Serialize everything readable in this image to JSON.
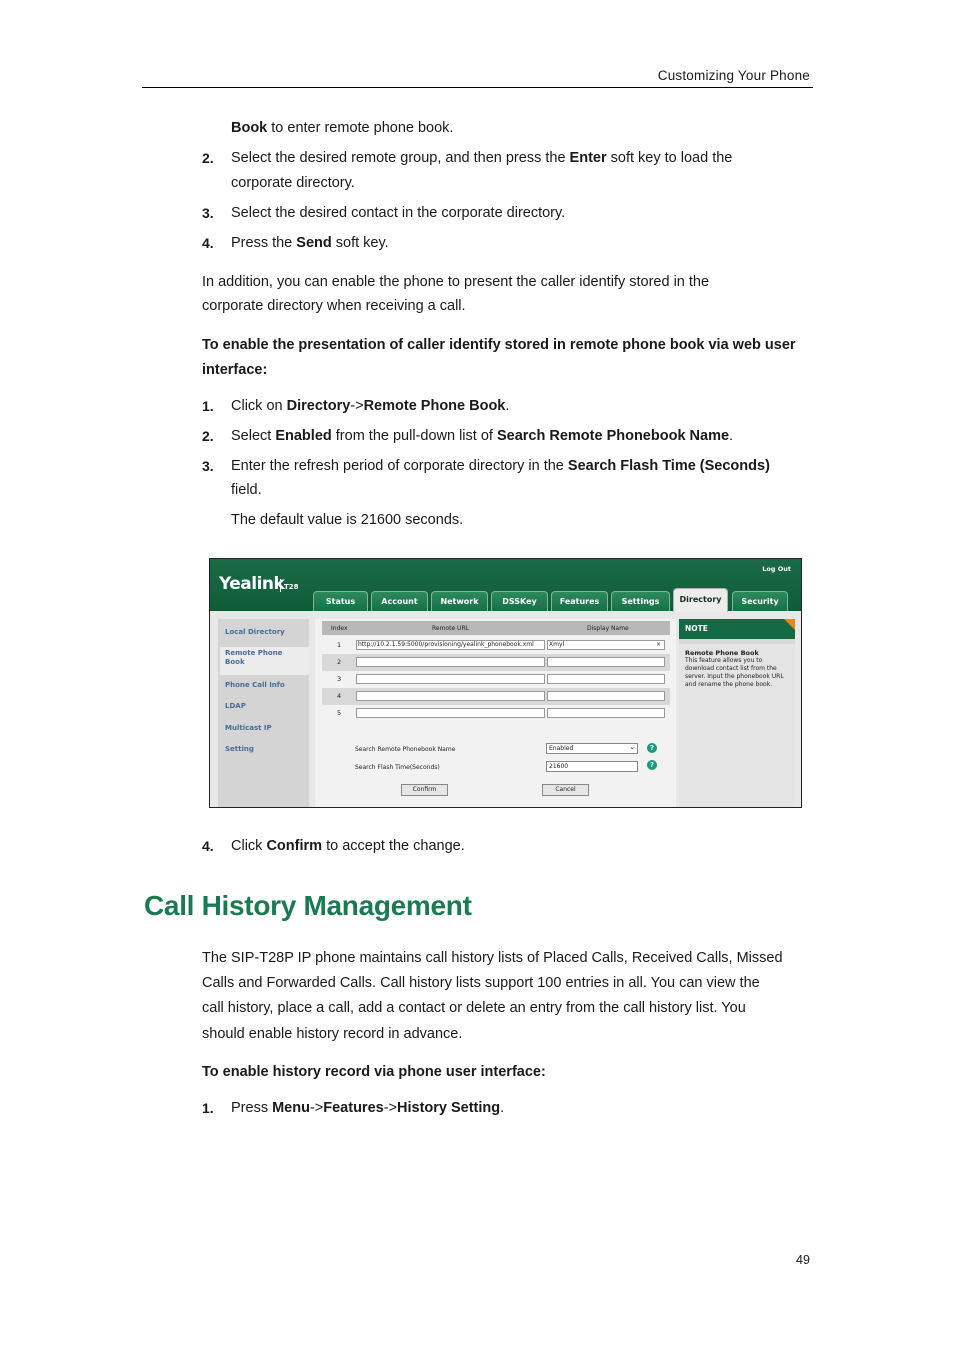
{
  "header": {
    "section_title": "Customizing  Your  Phone"
  },
  "top_steps": {
    "continuation_bold": "Book",
    "continuation_text": " to enter remote phone book.",
    "items": [
      {
        "num": "2.",
        "pre": "Select the desired remote group, and then press the ",
        "bold": "Enter",
        "post": " soft key to load the",
        "line2": "corporate directory."
      },
      {
        "num": "3.",
        "pre": "Select the desired contact in the corporate directory.",
        "bold": "",
        "post": ""
      },
      {
        "num": "4.",
        "pre": "Press the ",
        "bold": "Send",
        "post": " soft key."
      }
    ]
  },
  "intro": {
    "line1": "In addition, you can enable the phone to present the caller identify stored in the",
    "line2": "corporate directory  when receiving a call."
  },
  "procedure_web": {
    "heading_line1": "To enable the presentation of caller identify stored in remote phone book via web user",
    "heading_line2": "interface:",
    "steps": [
      {
        "num": "1.",
        "pre": "Click on ",
        "bold1": "Directory",
        "mid": "->",
        "bold2": "Remote Phone Book",
        "post": "."
      },
      {
        "num": "2.",
        "pre": "Select ",
        "bold1": "Enabled",
        "mid": " from the pull-down list of ",
        "bold2": "Search Remote Phonebook Name",
        "post": "."
      },
      {
        "num": "3.",
        "pre": "Enter the refresh period of corporate directory  in the ",
        "bold1": "Search Flash Time (Seconds)",
        "line2": "field.",
        "note": "The default value is 21600 seconds."
      }
    ],
    "step4": {
      "num": "4.",
      "pre": "Click ",
      "bold": "Confirm",
      "post": " to accept the change."
    }
  },
  "web_ui": {
    "logo": "Yealink",
    "model": "T28",
    "logout": "Log Out",
    "tabs": [
      "Status",
      "Account",
      "Network",
      "DSSKey",
      "Features",
      "Settings",
      "Directory",
      "Security"
    ],
    "active_tab": "Directory",
    "sidebar": [
      "Local Directory",
      "Remote Phone Book",
      "Phone Call Info",
      "LDAP",
      "Multicast IP",
      "Setting"
    ],
    "table_headers": [
      "Index",
      "Remote URL",
      "Display Name"
    ],
    "rows": [
      {
        "index": "1",
        "url": "http://10.2.1.59:5000/provisioning/yealink_phonebook.xml",
        "name": "Xmyl",
        "clear": "×"
      },
      {
        "index": "2",
        "url": "",
        "name": ""
      },
      {
        "index": "3",
        "url": "",
        "name": ""
      },
      {
        "index": "4",
        "url": "",
        "name": ""
      },
      {
        "index": "5",
        "url": "",
        "name": ""
      }
    ],
    "search_name_label": "Search Remote Phonebook Name",
    "search_name_value": "Enabled",
    "flash_time_label": "Search Flash Time(Seconds)",
    "flash_time_value": "21600",
    "help_glyph": "?",
    "confirm": "Confirm",
    "cancel": "Cancel",
    "note_header": "NOTE",
    "note_title": "Remote Phone Book",
    "note_text": "This feature allows you to download contact list from the server. Input the phonebook URL and rename the phone book."
  },
  "section": {
    "title": "Call History Management",
    "para": [
      "The SIP-T28P IP phone maintains call history lists of Placed Calls, Received Calls, Missed",
      "Calls and Forwarded Calls. Call history lists support 100 entries in all. You can view the",
      "call history, place a call, add a contact or delete an entry from the call history list. You",
      "should enable history record in advance."
    ],
    "proc_heading": "To enable history record via phone user interface:",
    "step1": {
      "num": "1.",
      "pre": "Press ",
      "b1": "Menu",
      "m1": "->",
      "b2": "Features",
      "m2": "->",
      "b3": "History Setting",
      "post": "."
    }
  },
  "page_number": "49"
}
